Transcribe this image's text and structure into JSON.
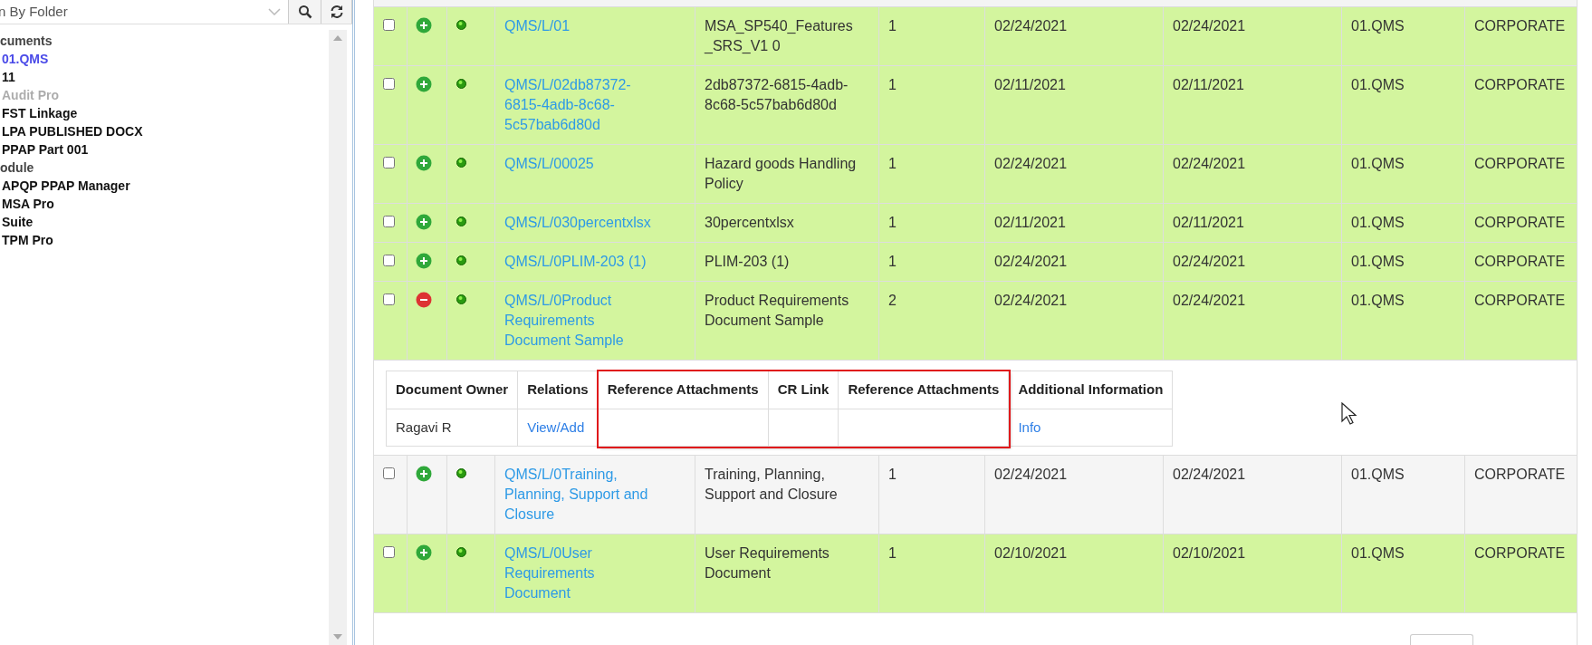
{
  "sidebar": {
    "filter": {
      "value": "n By Folder"
    },
    "tree": [
      {
        "label": "cuments",
        "children": [
          {
            "label": "01.QMS",
            "selected": true,
            "disabled": false
          },
          {
            "label": "11",
            "selected": false,
            "disabled": false
          },
          {
            "label": "Audit Pro",
            "selected": false,
            "disabled": true
          },
          {
            "label": "FST Linkage",
            "selected": false,
            "disabled": false
          },
          {
            "label": "LPA PUBLISHED DOCX",
            "selected": false,
            "disabled": false
          },
          {
            "label": "PPAP Part 001",
            "selected": false,
            "disabled": false
          }
        ]
      },
      {
        "label": "odule",
        "children": [
          {
            "label": "APQP PPAP Manager",
            "selected": false,
            "disabled": false
          },
          {
            "label": "MSA Pro",
            "selected": false,
            "disabled": false
          },
          {
            "label": "Suite",
            "selected": false,
            "disabled": false
          },
          {
            "label": "TPM Pro",
            "selected": false,
            "disabled": false
          }
        ]
      }
    ]
  },
  "table": {
    "rows": [
      {
        "checked": false,
        "expanded": false,
        "highlighted": true,
        "number": "QMS/L/01",
        "title": "MSA_SP540_Features_SRS_V1 0",
        "revision": "1",
        "date_1": "02/24/2021",
        "date_2": "02/24/2021",
        "folder": "01.QMS",
        "site": "CORPORATE"
      },
      {
        "checked": false,
        "expanded": false,
        "highlighted": true,
        "number": "QMS/L/02db87372-6815-4adb-8c68-5c57bab6d80d",
        "title": "2db87372-6815-4adb-8c68-5c57bab6d80d",
        "revision": "1",
        "date_1": "02/11/2021",
        "date_2": "02/11/2021",
        "folder": "01.QMS",
        "site": "CORPORATE"
      },
      {
        "checked": false,
        "expanded": false,
        "highlighted": true,
        "number": "QMS/L/00025",
        "title": "Hazard goods Handling Policy",
        "revision": "1",
        "date_1": "02/24/2021",
        "date_2": "02/24/2021",
        "folder": "01.QMS",
        "site": "CORPORATE"
      },
      {
        "checked": false,
        "expanded": false,
        "highlighted": true,
        "number": "QMS/L/030percentxlsx",
        "title": "30percentxlsx",
        "revision": "1",
        "date_1": "02/11/2021",
        "date_2": "02/11/2021",
        "folder": "01.QMS",
        "site": "CORPORATE"
      },
      {
        "checked": false,
        "expanded": false,
        "highlighted": true,
        "number": "QMS/L/0PLIM-203 (1)",
        "title": "PLIM-203 (1)",
        "revision": "1",
        "date_1": "02/24/2021",
        "date_2": "02/24/2021",
        "folder": "01.QMS",
        "site": "CORPORATE"
      },
      {
        "checked": false,
        "expanded": true,
        "highlighted": true,
        "number": "QMS/L/0Product Requirements Document Sample",
        "title": "Product Requirements Document Sample",
        "revision": "2",
        "date_1": "02/24/2021",
        "date_2": "02/24/2021",
        "folder": "01.QMS",
        "site": "CORPORATE",
        "details": {
          "columns": [
            {
              "heading": "Document Owner",
              "value": "Ragavi R",
              "kind": "text",
              "outlined": false
            },
            {
              "heading": "Relations",
              "value": "View/Add",
              "kind": "link",
              "outlined": false
            },
            {
              "heading": "Reference Attachments",
              "kind": "text",
              "outlined": true
            },
            {
              "heading": "CR Link",
              "kind": "text",
              "outlined": true
            },
            {
              "heading": "Reference Attachments",
              "kind": "text",
              "outlined": true
            },
            {
              "heading": "Additional Information",
              "value": "Info",
              "kind": "link",
              "outlined": false
            }
          ]
        }
      },
      {
        "checked": false,
        "expanded": false,
        "highlighted": false,
        "number": "QMS/L/0Training, Planning, Support and Closure",
        "title": "Training, Planning, Support and Closure",
        "revision": "1",
        "date_1": "02/24/2021",
        "date_2": "02/24/2021",
        "folder": "01.QMS",
        "site": "CORPORATE"
      },
      {
        "checked": false,
        "expanded": false,
        "highlighted": true,
        "number": "QMS/L/0User Requirements Document",
        "title": "User Requirements Document",
        "revision": "1",
        "date_1": "02/10/2021",
        "date_2": "02/10/2021",
        "folder": "01.QMS",
        "site": "CORPORATE"
      }
    ]
  }
}
